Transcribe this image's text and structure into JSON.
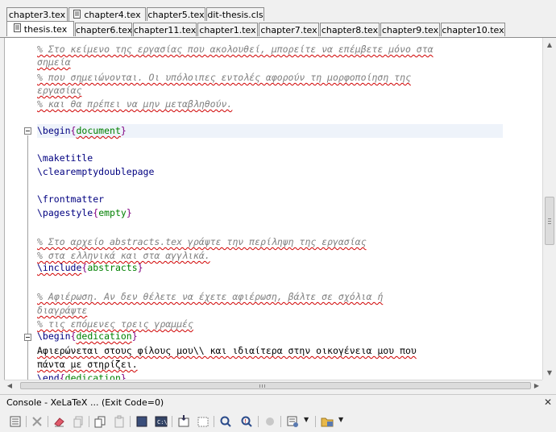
{
  "tabs_row1": [
    {
      "label": "chapter3.tex"
    },
    {
      "label": "chapter4.tex"
    },
    {
      "label": "chapter5.tex"
    },
    {
      "label": "dit-thesis.cls"
    }
  ],
  "tabs_row2": [
    {
      "label": "thesis.tex",
      "active": true
    },
    {
      "label": "chapter6.tex"
    },
    {
      "label": "chapter11.tex"
    },
    {
      "label": "chapter1.tex"
    },
    {
      "label": "chapter7.tex"
    },
    {
      "label": "chapter8.tex"
    },
    {
      "label": "chapter9.tex"
    },
    {
      "label": "chapter10.tex"
    }
  ],
  "code": {
    "c1a": "% Στο κείμενο της εργασίας που ακολουθεί, μπορείτε να επέμβετε μόνο στα",
    "c1b": "σημεία",
    "c2a": "% που σημειώνονται. Οι υπόλοιπες εντολές αφορούν τη μορφοποίηση της",
    "c2b": "εργασίας",
    "c3": "% και θα πρέπει να μην μεταβληθούν.",
    "begin_cmd": "\\begin",
    "begin_arg": "document",
    "maketitle": "\\maketitle",
    "cleardouble": "\\clearemptydoublepage",
    "frontmatter": "\\frontmatter",
    "pagestyle_cmd": "\\pagestyle",
    "pagestyle_arg": "empty",
    "c4": "% Στο αρχείο abstracts.tex γράψτε την περίληψη της εργασίας",
    "c5": "% στα ελληνικά και στα αγγλικά.",
    "include_cmd": "\\include",
    "include_arg": "abstracts",
    "c6a": "% Αφιέρωση. Αν δεν θέλετε να έχετε αφιέρωση, βάλτε σε σχόλια ή",
    "c6b": "διαγράψτε",
    "c7": "% τις επόμενες τρεις γραμμές",
    "begin2_cmd": "\\begin",
    "begin2_arg": "dedication",
    "ded_text1": "Αφιερώνεται στους φίλους μου\\\\ και ιδιαίτερα στην οικογένεια μου που",
    "ded_text2": "πάντα με στηρίζει.",
    "end_cmd": "\\end",
    "end_arg": "dedication"
  },
  "console": {
    "title": "Console - XeLaTeX ... (Exit Code=0)",
    "close_icon": "close-icon"
  },
  "colors": {
    "comment": "#808080",
    "command": "#000080",
    "argument": "#008000",
    "brace": "#800080",
    "spellcheck": "#d00000"
  }
}
